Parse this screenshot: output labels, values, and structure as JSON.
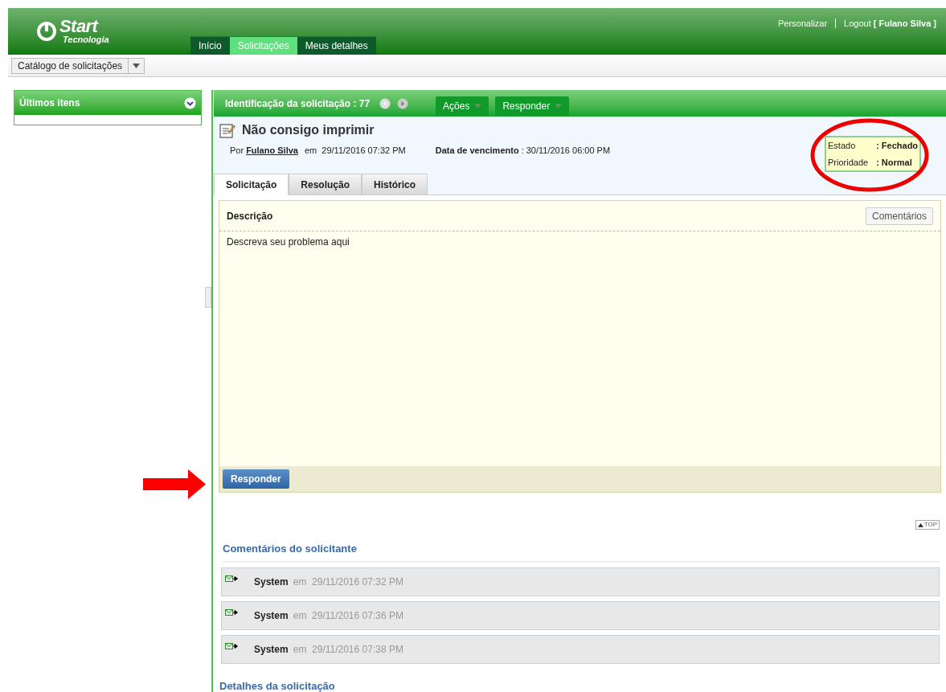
{
  "header": {
    "logo": {
      "name": "Start",
      "subtitle": "Tecnologia"
    },
    "links": [
      {
        "label": "Personalizar",
        "kind": "link"
      },
      {
        "label": "Logout",
        "kind": "logout",
        "user": "[ Fulano Silva ]"
      }
    ],
    "tabs": [
      {
        "label": "Início",
        "selected": false
      },
      {
        "label": "Solicitações",
        "selected": true
      },
      {
        "label": "Meus detalhes",
        "selected": false
      }
    ]
  },
  "toolbar": {
    "dropdown": "Catálogo de solicitações"
  },
  "sidebar": {
    "panel_title": "Últimos itens"
  },
  "request": {
    "id_label": "Identificação da solicitação : 77",
    "menus": [
      "Ações",
      "Responder"
    ],
    "title": "Não consigo imprimir",
    "by_label": "Por",
    "author": "Fulano Silva",
    "created": "em  29/11/2016 07:32 PM",
    "due_label": "Data de vencimento",
    "due": ": 30/11/2016 06:00 PM",
    "status": [
      {
        "label": "Estado",
        "value": ": Fechado"
      },
      {
        "label": "Prioridade",
        "value": ": Normal"
      }
    ],
    "tabs": [
      {
        "label": "Solicitação",
        "selected": true
      },
      {
        "label": "Resolução",
        "selected": false
      },
      {
        "label": "Histórico",
        "selected": false
      }
    ],
    "description_label": "Descrição",
    "comments_button": "Comentários",
    "description": "Descreva seu problema aqui",
    "reply_button": "Responder"
  },
  "top_link": "TOP",
  "comments": {
    "title": "Comentários do solicitante",
    "items": [
      {
        "author": "System",
        "time": "em  29/11/2016 07:32 PM"
      },
      {
        "author": "System",
        "time": "em  29/11/2016 07:36 PM"
      },
      {
        "author": "System",
        "time": "em  29/11/2016 07:38 PM"
      }
    ]
  },
  "details_title": "Detalhes da solicitação"
}
